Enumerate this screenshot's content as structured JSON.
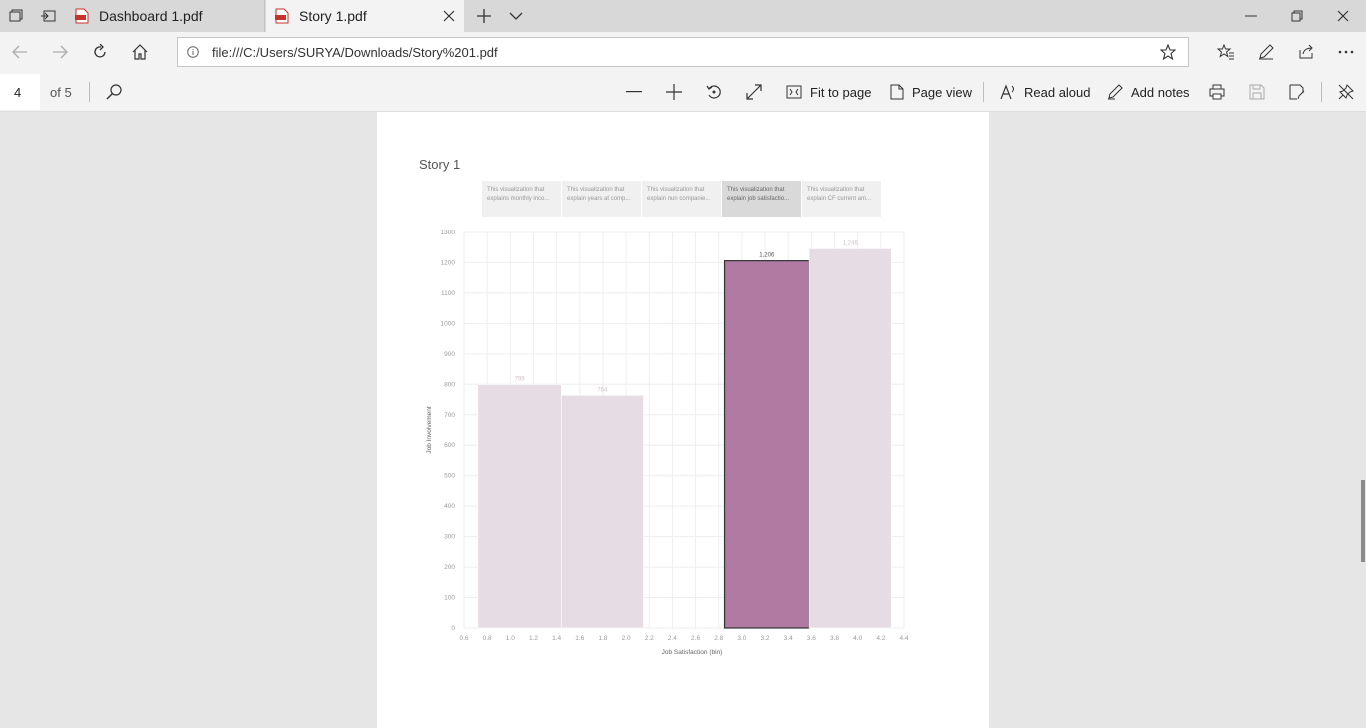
{
  "browser": {
    "tabs": [
      {
        "title": "Dashboard 1.pdf",
        "active": false
      },
      {
        "title": "Story 1.pdf",
        "active": true
      }
    ],
    "address_url": "file:///C:/Users/SURYA/Downloads/Story%201.pdf"
  },
  "pdf_toolbar": {
    "page_number": "4",
    "page_count_label": "of 5",
    "fit_to_page": "Fit to page",
    "page_view": "Page view",
    "read_aloud": "Read aloud",
    "add_notes": "Add notes"
  },
  "story": {
    "title": "Story 1",
    "tabs": [
      "This visualization that explains monthly inco...",
      "This visualization that explain years at comp...",
      "This visualization that explain nun companie...",
      "This visualization that explain job satisfactio...",
      "This visualization that explain CF current am..."
    ],
    "active_tab_index": 3
  },
  "chart_data": {
    "type": "bar",
    "xlabel": "Job Satisfaction (bin)",
    "ylabel": "Job Involvement",
    "x_ticks": [
      "0.6",
      "0.8",
      "1.0",
      "1.2",
      "1.4",
      "1.6",
      "1.8",
      "2.0",
      "2.2",
      "2.4",
      "2.6",
      "2.8",
      "3.0",
      "3.2",
      "3.4",
      "3.6",
      "3.8",
      "4.0",
      "4.2",
      "4.4"
    ],
    "y_ticks": [
      "0",
      "100",
      "200",
      "300",
      "400",
      "500",
      "600",
      "700",
      "800",
      "900",
      "1000",
      "1100",
      "1200",
      "1300"
    ],
    "xlim": [
      0.6,
      4.4
    ],
    "ylim": [
      0,
      1300
    ],
    "bars": [
      {
        "x0": 0.72,
        "x1": 1.44,
        "value": 799,
        "label": "799",
        "highlight": false
      },
      {
        "x0": 1.44,
        "x1": 2.15,
        "value": 764,
        "label": "764",
        "highlight": false
      },
      {
        "x0": 2.85,
        "x1": 3.58,
        "value": 1206,
        "label": "1,206",
        "highlight": true
      },
      {
        "x0": 3.58,
        "x1": 4.29,
        "value": 1246,
        "label": "1,246",
        "highlight": false
      }
    ],
    "colors": {
      "muted": "#e6dce4",
      "highlight": "#b07aa2",
      "grid": "#eeeeee",
      "tick": "#9a9a9a"
    }
  }
}
